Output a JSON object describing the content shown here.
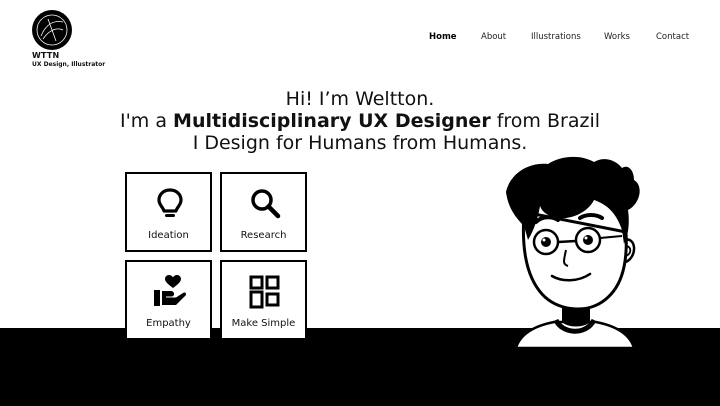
{
  "logo": {
    "name": "WTTN",
    "tagline": "UX Design, Illustrator"
  },
  "nav": {
    "items": [
      {
        "label": "Home",
        "active": true
      },
      {
        "label": "About",
        "active": false
      },
      {
        "label": "Illustrations",
        "active": false
      },
      {
        "label": "Works",
        "active": false
      },
      {
        "label": "Contact",
        "active": false
      }
    ]
  },
  "hero": {
    "line1": "Hi! I’m Weltton.",
    "line2_prefix": "I'm a ",
    "line2_bold": "Multidisciplinary UX Designer",
    "line2_suffix": " from Brazil",
    "line3": "I Design for Humans from Humans."
  },
  "skills": [
    {
      "label": "Ideation",
      "icon": "lightbulb-icon"
    },
    {
      "label": "Research",
      "icon": "magnifier-icon"
    },
    {
      "label": "Empathy",
      "icon": "hand-heart-icon"
    },
    {
      "label": "Make Simple",
      "icon": "layout-grid-icon"
    }
  ],
  "colors": {
    "background": "#ffffff",
    "ink": "#000000"
  }
}
